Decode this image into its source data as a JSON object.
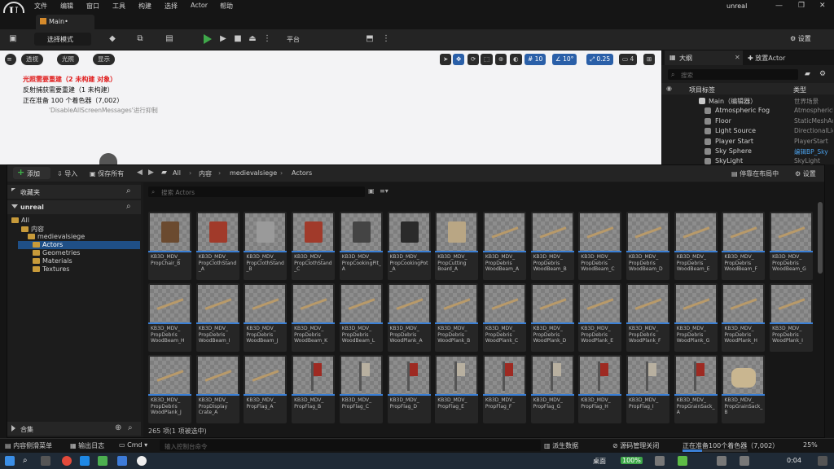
{
  "menubar": {
    "items": [
      "文件",
      "编辑",
      "窗口",
      "工具",
      "构建",
      "选择",
      "Actor",
      "帮助"
    ],
    "app_name": "unreal",
    "logo_text": "U"
  },
  "tab": {
    "title": "Main•"
  },
  "toolbar": {
    "mode_label": "选择模式",
    "platform_label": "平台",
    "settings_label": "设置"
  },
  "viewport": {
    "pills": [
      "透视",
      "光照",
      "显示"
    ],
    "chips": [
      "10",
      "10°",
      "0.25",
      "4"
    ],
    "warnings": [
      "光照需要重建（2 未构建 对象）",
      "反射捕获需要重建（1 未构建）",
      "正在准备 100 个着色器（7,002）",
      "'DisableAllScreenMessages'进行抑制"
    ]
  },
  "outliner": {
    "tab_label": "大纲",
    "tab2_label": "放置Actor",
    "search_placeholder": "搜索",
    "col_label": "项目标签",
    "col_type": "类型",
    "rows": [
      {
        "name": "Main（编辑器）",
        "type": "世界场景"
      },
      {
        "name": "Atmospheric Fog",
        "type": "AtmosphericFog"
      },
      {
        "name": "Floor",
        "type": "StaticMeshActor"
      },
      {
        "name": "Light Source",
        "type": "DirectionalLight"
      },
      {
        "name": "Player Start",
        "type": "PlayerStart"
      },
      {
        "name": "Sky Sphere",
        "type": "编辑BP_Sky"
      },
      {
        "name": "SkyLight",
        "type": "SkyLight"
      }
    ],
    "type_link_color": "#4a9fe8"
  },
  "content_browser": {
    "add_label": "添加",
    "import_label": "导入",
    "save_all_label": "保存所有",
    "breadcrumbs": [
      "All",
      "内容",
      "medievalsiege",
      "Actors"
    ],
    "dock_label": "停靠在布局中",
    "settings_label": "设置",
    "favorites_label": "收藏夹",
    "project_label": "unreal",
    "search_placeholder": "搜索 Actors",
    "tree": [
      "All",
      "内容",
      "medievalsiege",
      "Actors",
      "Geometries",
      "Materials",
      "Textures"
    ],
    "collections_label": "合集",
    "status": "265 项(1 项被选中)",
    "assets": [
      [
        "KB3D_MDV_",
        "PropChair_B"
      ],
      [
        "KB3D_MDV_",
        "PropClothStand",
        "_A"
      ],
      [
        "KB3D_MDV_",
        "PropClothStand",
        "_B"
      ],
      [
        "KB3D_MDV_",
        "PropClothStand",
        "_C"
      ],
      [
        "KB3D_MDV_",
        "PropCookingPit_",
        "A"
      ],
      [
        "KB3D_MDV_",
        "PropCookingPot",
        "_A"
      ],
      [
        "KB3D_MDV_",
        "PropCutting",
        "Board_A"
      ],
      [
        "KB3D_MDV_",
        "PropDebris",
        "WoodBeam_A"
      ],
      [
        "KB3D_MDV_",
        "PropDebris",
        "WoodBeam_B"
      ],
      [
        "KB3D_MDV_",
        "PropDebris",
        "WoodBeam_C"
      ],
      [
        "KB3D_MDV_",
        "PropDebris",
        "WoodBeam_D"
      ],
      [
        "KB3D_MDV_",
        "PropDebris",
        "WoodBeam_E"
      ],
      [
        "KB3D_MDV_",
        "PropDebris",
        "WoodBeam_F"
      ],
      [
        "KB3D_MDV_",
        "PropDebris",
        "WoodBeam_G"
      ],
      [
        "KB3D_MDV_",
        "PropDebris",
        "WoodBeam_H"
      ],
      [
        "KB3D_MDV_",
        "PropDebris",
        "WoodBeam_I"
      ],
      [
        "KB3D_MDV_",
        "PropDebris",
        "WoodBeam_J"
      ],
      [
        "KB3D_MDV_",
        "PropDebris",
        "WoodBeam_K"
      ],
      [
        "KB3D_MDV_",
        "PropDebris",
        "WoodBeam_L"
      ],
      [
        "KB3D_MDV_",
        "PropDebris",
        "WoodPlank_A"
      ],
      [
        "KB3D_MDV_",
        "PropDebris",
        "WoodPlank_B"
      ],
      [
        "KB3D_MDV_",
        "PropDebris",
        "WoodPlank_C"
      ],
      [
        "KB3D_MDV_",
        "PropDebris",
        "WoodPlank_D"
      ],
      [
        "KB3D_MDV_",
        "PropDebris",
        "WoodPlank_E"
      ],
      [
        "KB3D_MDV_",
        "PropDebris",
        "WoodPlank_F"
      ],
      [
        "KB3D_MDV_",
        "PropDebris",
        "WoodPlank_G"
      ],
      [
        "KB3D_MDV_",
        "PropDebris",
        "WoodPlank_H"
      ],
      [
        "KB3D_MDV_",
        "PropDebris",
        "WoodPlank_I"
      ],
      [
        "KB3D_MDV_",
        "PropDebris",
        "WoodPlank_J"
      ],
      [
        "KB3D_MDV_",
        "PropDisplay",
        "Crate_A"
      ],
      [
        "KB3D_MDV_",
        "PropFlag_A"
      ],
      [
        "KB3D_MDV_",
        "PropFlag_B"
      ],
      [
        "KB3D_MDV_",
        "PropFlag_C"
      ],
      [
        "KB3D_MDV_",
        "PropFlag_D"
      ],
      [
        "KB3D_MDV_",
        "PropFlag_E"
      ],
      [
        "KB3D_MDV_",
        "PropFlag_F"
      ],
      [
        "KB3D_MDV_",
        "PropFlag_G"
      ],
      [
        "KB3D_MDV_",
        "PropFlag_H"
      ],
      [
        "KB3D_MDV_",
        "PropFlag_I"
      ],
      [
        "KB3D_MDV_",
        "PropGrainSack_",
        "A"
      ],
      [
        "KB3D_MDV_",
        "PropGrainSack_",
        "B"
      ]
    ]
  },
  "statusbar": {
    "drawer_label": "内容侧滑菜单",
    "log_label": "输出日志",
    "cmd_label": "Cmd",
    "cmd_placeholder": "输入控制台命令",
    "derived_label": "派生数据",
    "source_control_label": "源码管理关闭",
    "shader_status": "正在准备100个着色器（7,002）",
    "percent": "25%",
    "progress_fraction": 0.3
  },
  "taskbar": {
    "desktop_label": "桌面",
    "battery": "100%",
    "time": "0:04"
  }
}
